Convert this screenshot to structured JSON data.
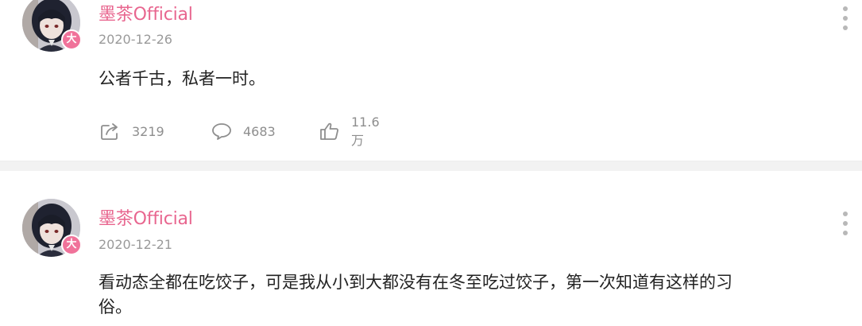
{
  "posts": [
    {
      "username": "墨茶Official",
      "badge": "大",
      "date": "2020-12-26",
      "content": "公者千古，私者一时。",
      "actions": {
        "share": "3219",
        "comment": "4683",
        "like": "11.6万"
      }
    },
    {
      "username": "墨茶Official",
      "badge": "大",
      "date": "2020-12-21",
      "content": "看动态全都在吃饺子，可是我从小到大都没有在冬至吃过饺子，第一次知道有这样的习俗。"
    }
  ],
  "colors": {
    "username": "#e8668f",
    "badge": "#f0729a",
    "meta": "#9a9a9a",
    "divider": "#f2f2f2"
  },
  "icons": {
    "share": "share-icon",
    "comment": "comment-icon",
    "like": "thumbs-up-icon",
    "more": "more-vertical-icon"
  }
}
